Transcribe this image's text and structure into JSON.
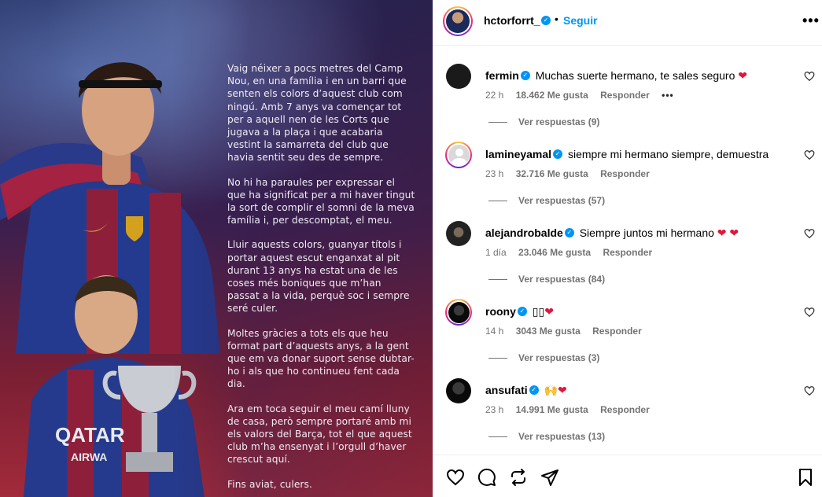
{
  "post": {
    "paragraphs": [
      "Vaig néixer a pocs metres del Camp Nou, en una família i en un barri que senten els colors d’aquest club com ningú. Amb 7 anys va començar tot per a aquell nen de les Corts que jugava a la plaça i que acabaria vestint la samarreta del club que havia sentit seu des de sempre.",
      "No hi ha paraules per expressar el que ha significat per a mi haver tingut la sort de complir el somni de la meva família i, per descomptat, el meu.",
      "Lluir aquests colors, guanyar títols i portar aquest escut enganxat al pit durant 13 anys ha estat una de les coses més boniques que m’han passat a la vida, perquè soc i sempre seré culer.",
      "Moltes gràcies a tots els que heu format part d’aquests anys, a la gent que em va donar suport sense dubtar-ho i als que ho continueu fent cada dia.",
      "Ara em toca seguir el meu camí lluny de casa, però sempre portaré amb mi els valors del Barça, tot el que aquest club m’ha ensenyat i l’orgull d’haver crescut aquí.",
      "Fins aviat, culers."
    ],
    "image_text": {
      "shirt_sponsor": "QATAR",
      "shirt_sponsor_line2": "AIRWA"
    }
  },
  "header": {
    "username": "hctorforrt_",
    "dot": "•",
    "follow_label": "Seguir",
    "more_label": "•••"
  },
  "comments": [
    {
      "user": "fermin",
      "text": "Muchas suerte hermano, te sales seguro",
      "emoji": "❤",
      "time": "22 h",
      "likes": "18.462 Me gusta",
      "reply": "Responder",
      "more": "•••",
      "replies": "Ver respuestas (9)"
    },
    {
      "user": "lamineyamal",
      "text": "siempre mi hermano siempre, demuestra",
      "emoji": "",
      "time": "23 h",
      "likes": "32.716 Me gusta",
      "reply": "Responder",
      "more": "",
      "replies": "Ver respuestas (57)"
    },
    {
      "user": "alejandrobalde",
      "text": "Siempre juntos mi hermano",
      "emoji": "❤ ❤",
      "time": "1 día",
      "likes": "23.046 Me gusta",
      "reply": "Responder",
      "more": "",
      "replies": "Ver respuestas (84)"
    },
    {
      "user": "roony",
      "text": "▯▯",
      "emoji": "❤",
      "time": "14 h",
      "likes": "3043 Me gusta",
      "reply": "Responder",
      "more": "",
      "replies": "Ver respuestas (3)"
    },
    {
      "user": "ansufati",
      "text": "🙌",
      "emoji": "❤",
      "time": "23 h",
      "likes": "14.991 Me gusta",
      "reply": "Responder",
      "more": "",
      "replies": "Ver respuestas (13)"
    }
  ],
  "colors": {
    "link_blue": "#0095f6",
    "heart_red": "#e0163a",
    "meta_gray": "#737373"
  },
  "icons": [
    "heart-icon",
    "comment-icon",
    "repost-icon",
    "share-icon",
    "bookmark-icon",
    "verified-icon",
    "more-icon"
  ]
}
